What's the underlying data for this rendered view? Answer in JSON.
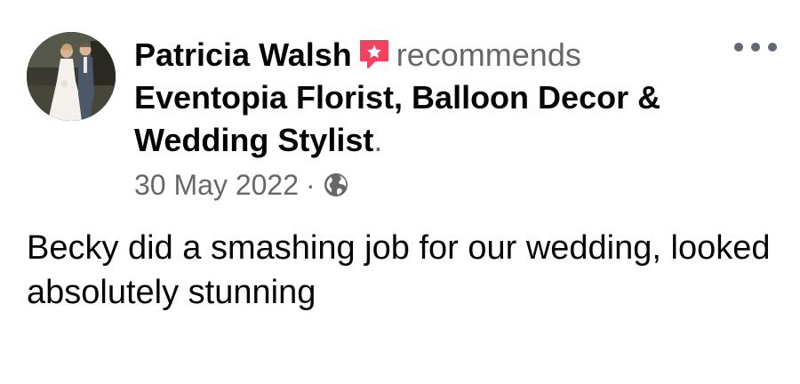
{
  "post": {
    "author_name": "Patricia Walsh",
    "recommendation_icon": "recommend-star-icon",
    "verb": "recommends",
    "page_name": "Eventopia Florist, Balloon Decor & Wedding Stylist",
    "period": ".",
    "date": "30 May 2022",
    "separator": "·",
    "audience_icon": "globe-icon",
    "more_icon": "more-options-icon",
    "text": "Becky did a smashing job for our wedding, looked absolutely stunning"
  },
  "colors": {
    "primary_text": "#050505",
    "secondary_text": "#65676b",
    "recommend_icon": "#f3425f",
    "background": "#ffffff"
  }
}
